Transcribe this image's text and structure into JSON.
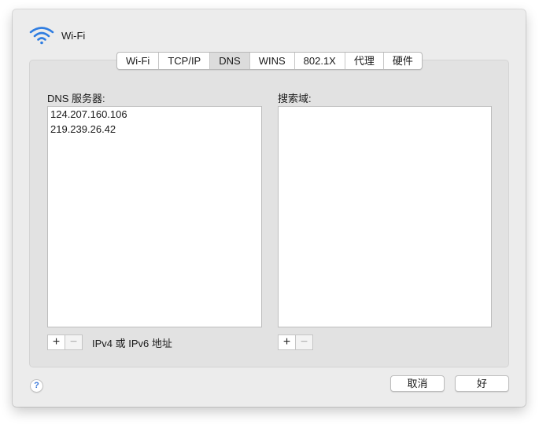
{
  "window": {
    "title": "Wi-Fi",
    "icon": "wifi-icon"
  },
  "tabs": [
    {
      "label": "Wi-Fi",
      "selected": false
    },
    {
      "label": "TCP/IP",
      "selected": false
    },
    {
      "label": "DNS",
      "selected": true
    },
    {
      "label": "WINS",
      "selected": false
    },
    {
      "label": "802.1X",
      "selected": false
    },
    {
      "label": "代理",
      "selected": false
    },
    {
      "label": "硬件",
      "selected": false
    }
  ],
  "dns": {
    "label": "DNS 服务器:",
    "servers": [
      "124.207.160.106",
      "219.239.26.42"
    ],
    "add": "+",
    "remove": "−",
    "hint": "IPv4 或 IPv6 地址"
  },
  "search_domains": {
    "label": "搜索域:",
    "items": [],
    "add": "+",
    "remove": "−"
  },
  "footer": {
    "help": "?",
    "cancel": "取消",
    "ok": "好"
  },
  "colors": {
    "window_bg": "#ececec",
    "group_bg": "#e2e2e2",
    "accent": "#3a78d8"
  }
}
